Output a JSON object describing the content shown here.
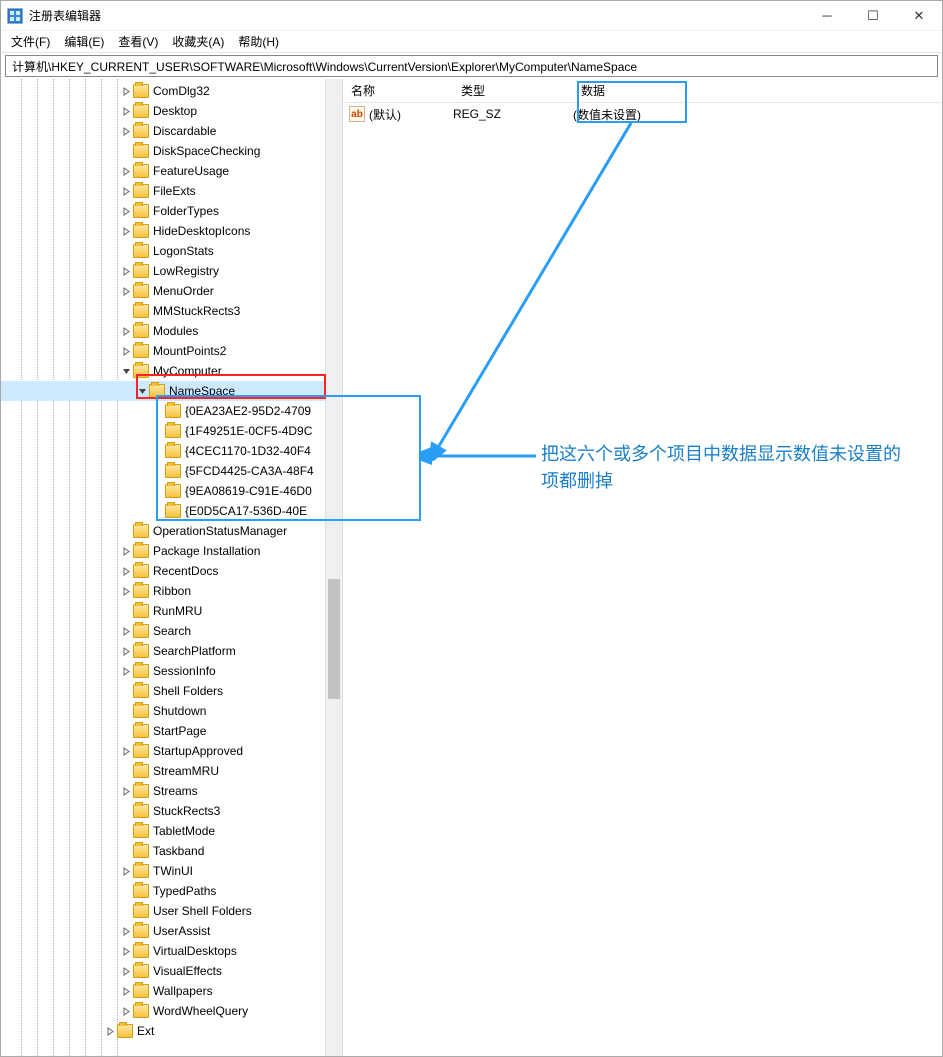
{
  "window": {
    "title": "注册表编辑器"
  },
  "menu": {
    "file": "文件(F)",
    "edit": "编辑(E)",
    "view": "查看(V)",
    "favorites": "收藏夹(A)",
    "help": "帮助(H)"
  },
  "address": "计算机\\HKEY_CURRENT_USER\\SOFTWARE\\Microsoft\\Windows\\CurrentVersion\\Explorer\\MyComputer\\NameSpace",
  "tree": {
    "items": [
      {
        "label": "ComDlg32",
        "depth": 7,
        "expander": ">"
      },
      {
        "label": "Desktop",
        "depth": 7,
        "expander": ">"
      },
      {
        "label": "Discardable",
        "depth": 7,
        "expander": ">"
      },
      {
        "label": "DiskSpaceChecking",
        "depth": 7,
        "expander": ""
      },
      {
        "label": "FeatureUsage",
        "depth": 7,
        "expander": ">"
      },
      {
        "label": "FileExts",
        "depth": 7,
        "expander": ">"
      },
      {
        "label": "FolderTypes",
        "depth": 7,
        "expander": ">"
      },
      {
        "label": "HideDesktopIcons",
        "depth": 7,
        "expander": ">"
      },
      {
        "label": "LogonStats",
        "depth": 7,
        "expander": ""
      },
      {
        "label": "LowRegistry",
        "depth": 7,
        "expander": ">"
      },
      {
        "label": "MenuOrder",
        "depth": 7,
        "expander": ">"
      },
      {
        "label": "MMStuckRects3",
        "depth": 7,
        "expander": ""
      },
      {
        "label": "Modules",
        "depth": 7,
        "expander": ">"
      },
      {
        "label": "MountPoints2",
        "depth": 7,
        "expander": ">"
      },
      {
        "label": "MyComputer",
        "depth": 7,
        "expander": "v"
      },
      {
        "label": "NameSpace",
        "depth": 8,
        "expander": "v",
        "selected": true
      },
      {
        "label": "{0EA23AE2-95D2-4709",
        "depth": 9,
        "expander": ""
      },
      {
        "label": "{1F49251E-0CF5-4D9C",
        "depth": 9,
        "expander": ""
      },
      {
        "label": "{4CEC1170-1D32-40F4",
        "depth": 9,
        "expander": ""
      },
      {
        "label": "{5FCD4425-CA3A-48F4",
        "depth": 9,
        "expander": ""
      },
      {
        "label": "{9EA08619-C91E-46D0",
        "depth": 9,
        "expander": ""
      },
      {
        "label": "{E0D5CA17-536D-40E",
        "depth": 9,
        "expander": ""
      },
      {
        "label": "OperationStatusManager",
        "depth": 7,
        "expander": ""
      },
      {
        "label": "Package Installation",
        "depth": 7,
        "expander": ">"
      },
      {
        "label": "RecentDocs",
        "depth": 7,
        "expander": ">"
      },
      {
        "label": "Ribbon",
        "depth": 7,
        "expander": ">"
      },
      {
        "label": "RunMRU",
        "depth": 7,
        "expander": ""
      },
      {
        "label": "Search",
        "depth": 7,
        "expander": ">"
      },
      {
        "label": "SearchPlatform",
        "depth": 7,
        "expander": ">"
      },
      {
        "label": "SessionInfo",
        "depth": 7,
        "expander": ">"
      },
      {
        "label": "Shell Folders",
        "depth": 7,
        "expander": ""
      },
      {
        "label": "Shutdown",
        "depth": 7,
        "expander": ""
      },
      {
        "label": "StartPage",
        "depth": 7,
        "expander": ""
      },
      {
        "label": "StartupApproved",
        "depth": 7,
        "expander": ">"
      },
      {
        "label": "StreamMRU",
        "depth": 7,
        "expander": ""
      },
      {
        "label": "Streams",
        "depth": 7,
        "expander": ">"
      },
      {
        "label": "StuckRects3",
        "depth": 7,
        "expander": ""
      },
      {
        "label": "TabletMode",
        "depth": 7,
        "expander": ""
      },
      {
        "label": "Taskband",
        "depth": 7,
        "expander": ""
      },
      {
        "label": "TWinUI",
        "depth": 7,
        "expander": ">"
      },
      {
        "label": "TypedPaths",
        "depth": 7,
        "expander": ""
      },
      {
        "label": "User Shell Folders",
        "depth": 7,
        "expander": ""
      },
      {
        "label": "UserAssist",
        "depth": 7,
        "expander": ">"
      },
      {
        "label": "VirtualDesktops",
        "depth": 7,
        "expander": ">"
      },
      {
        "label": "VisualEffects",
        "depth": 7,
        "expander": ">"
      },
      {
        "label": "Wallpapers",
        "depth": 7,
        "expander": ">"
      },
      {
        "label": "WordWheelQuery",
        "depth": 7,
        "expander": ">"
      },
      {
        "label": "Ext",
        "depth": 6,
        "expander": ">"
      }
    ]
  },
  "list": {
    "headers": {
      "name": "名称",
      "type": "类型",
      "data": "数据"
    },
    "rows": [
      {
        "name": "(默认)",
        "type": "REG_SZ",
        "data": "(数值未设置)"
      }
    ]
  },
  "annotation": {
    "text": "把这六个或多个项目中数据显示数值未设置的项都删掉"
  }
}
